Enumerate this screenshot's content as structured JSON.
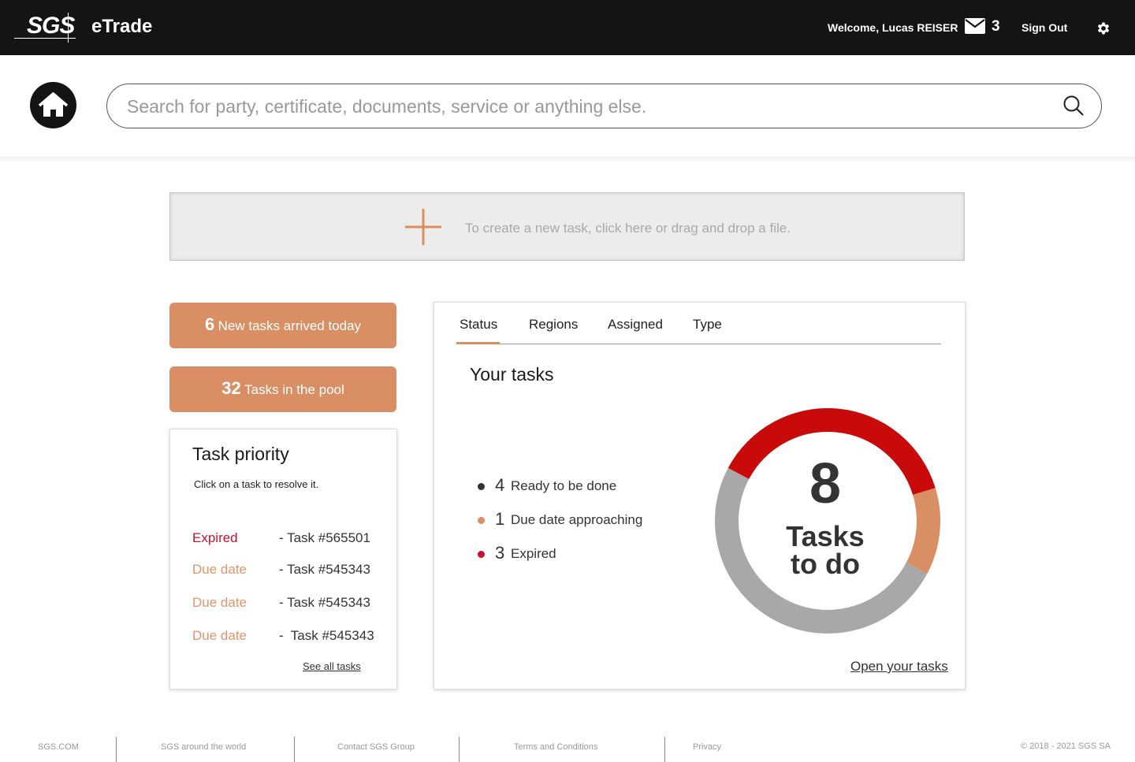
{
  "header": {
    "logo_text": "SGS",
    "app_title": "eTrade",
    "welcome": "Welcome, Lucas REISER",
    "mail_count": "3",
    "sign_out": "Sign Out",
    "icons": [
      "mail-icon",
      "gear-icon"
    ]
  },
  "search": {
    "placeholder": "Search for party, certificate, documents, service or anything else."
  },
  "create_task": {
    "text": "To create a new task, click here or drag and drop a file.",
    "icon": "plus-icon"
  },
  "summary_buttons": [
    {
      "count": "6",
      "label": "New tasks arrived today"
    },
    {
      "count": "32",
      "label": "Tasks in the pool"
    }
  ],
  "priority": {
    "title": "Task priority",
    "subtitle": "Click on a task to resolve it.",
    "rows": [
      {
        "status": "Expired",
        "task": "- Task #565501"
      },
      {
        "status": "Due date",
        "task": "- Task #545343"
      },
      {
        "status": "Due date",
        "task": "- Task #545343"
      },
      {
        "status": "Due date",
        "task": "-  Task #545343"
      }
    ],
    "see_all": "See all tasks"
  },
  "tasks_panel": {
    "tabs": [
      "Status",
      "Regions",
      "Assigned",
      "Type"
    ],
    "active_tab": "Status",
    "title": "Your tasks",
    "legend": [
      {
        "count": "4",
        "label": "Ready to be done",
        "color": "#333333"
      },
      {
        "count": "1",
        "label": "Due date approaching",
        "color": "#d98e64"
      },
      {
        "count": "3",
        "label": "Expired",
        "color": "#c8102e"
      }
    ],
    "donut_total": "8",
    "donut_label_line1": "Tasks",
    "donut_label_line2": "to do",
    "open_link": "Open your tasks"
  },
  "chart_data": {
    "type": "pie",
    "categories": [
      "Ready to be done",
      "Due date approaching",
      "Expired"
    ],
    "values": [
      4,
      1,
      3
    ],
    "colors": [
      "#a8a8a8",
      "#d98e64",
      "#c80a0a"
    ]
  },
  "footer": {
    "links": [
      "SGS.COM",
      "SGS around the world",
      "Contact SGS Group",
      "Terms and Conditions",
      "Privacy"
    ],
    "copyright": "© 2018 - 2021 SGS SA"
  },
  "colors": {
    "accent": "#d98e64",
    "expired": "#c8102e",
    "topbar": "#141414"
  }
}
